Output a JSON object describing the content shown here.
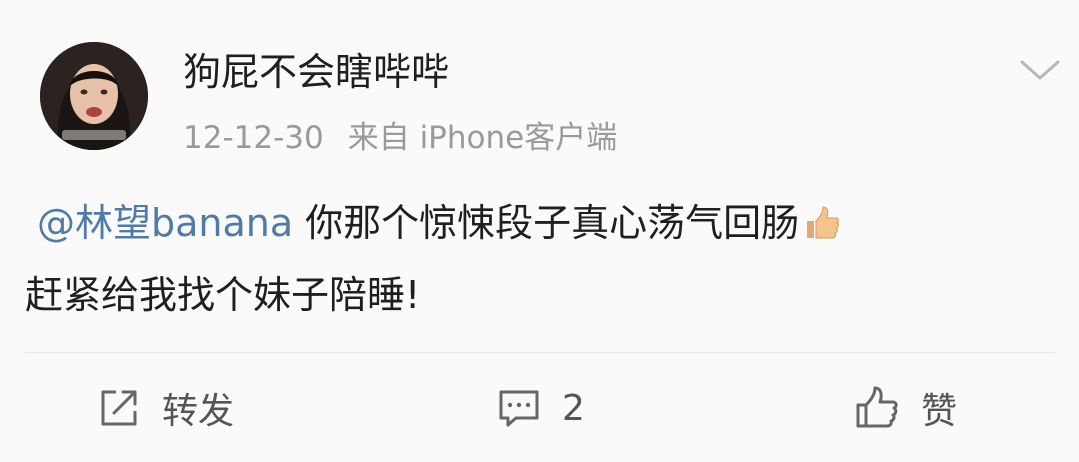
{
  "post": {
    "username": "狗屁不会瞎哔哔",
    "date": "12-12-30",
    "source": "来自 iPhone客户端",
    "mention": "@林望banana",
    "line1_text": "你那个惊悚段子真心荡气回肠",
    "line2_text": "赶紧给我找个妹子陪睡!",
    "emoji": "thumbs-up-icon"
  },
  "actions": {
    "forward_label": "转发",
    "comment_count": "2",
    "like_label": "赞"
  },
  "icons": {
    "avatar": "avatar-photo",
    "menu": "chevron-down-icon",
    "forward": "share-icon",
    "comment": "comment-icon",
    "like": "thumbs-up-icon"
  }
}
